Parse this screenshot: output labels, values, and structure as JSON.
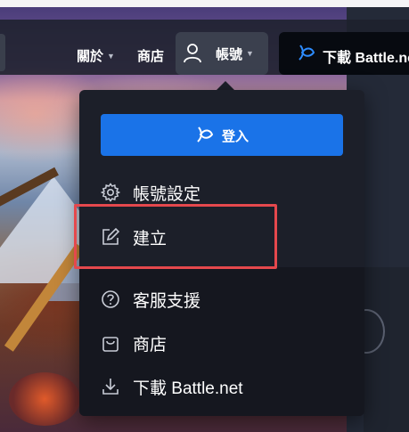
{
  "nav": {
    "about_label": "關於",
    "shop_label": "商店",
    "account_label": "帳號",
    "download_label": "下載 Battle.net"
  },
  "dropdown": {
    "login_label": "登入",
    "items": [
      {
        "label": "帳號設定",
        "icon": "gear-icon"
      },
      {
        "label": "建立",
        "icon": "edit-icon"
      },
      {
        "label": "客服支援",
        "icon": "help-icon"
      },
      {
        "label": "商店",
        "icon": "shopping-bag-icon"
      },
      {
        "label": "下載 Battle.net",
        "icon": "download-icon"
      }
    ]
  },
  "colors": {
    "accent_blue": "#1a73e8",
    "highlight_red": "#e5484d",
    "menu_bg": "#1c1f29"
  }
}
